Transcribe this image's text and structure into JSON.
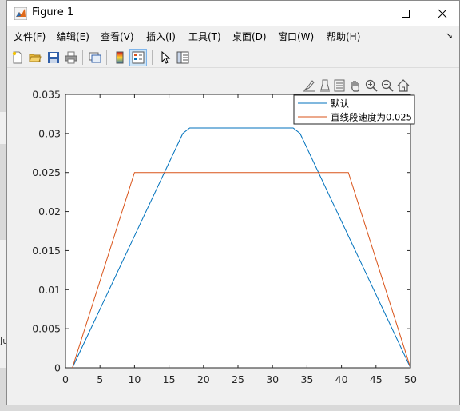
{
  "window": {
    "title": "Figure 1"
  },
  "background_fragments": [
    "Ju"
  ],
  "menu": {
    "items": [
      "文件(F)",
      "编辑(E)",
      "查看(V)",
      "插入(I)",
      "工具(T)",
      "桌面(D)",
      "窗口(W)",
      "帮助(H)"
    ],
    "overflow": "↘"
  },
  "toolbar": {
    "buttons": [
      "new-figure-icon",
      "open-file-icon",
      "save-icon",
      "print-icon",
      "link-plot-icon",
      "insert-colorbar-icon",
      "insert-legend-icon",
      "edit-plot-icon",
      "property-inspector-icon"
    ],
    "active": "insert-legend-icon"
  },
  "axes_toolbar": [
    "brush-icon",
    "data-tips-icon",
    "save-export-icon",
    "pan-icon",
    "zoom-in-icon",
    "zoom-out-icon",
    "restore-view-icon"
  ],
  "colors": {
    "series1": "#0072BD",
    "series2": "#D95319"
  },
  "chart_data": {
    "type": "line",
    "title": "",
    "xlabel": "",
    "ylabel": "",
    "xlim": [
      0,
      50
    ],
    "ylim": [
      0,
      0.035
    ],
    "xticks": [
      0,
      5,
      10,
      15,
      20,
      25,
      30,
      35,
      40,
      45,
      50
    ],
    "yticks": [
      0,
      0.005,
      0.01,
      0.015,
      0.02,
      0.025,
      0.03,
      0.035
    ],
    "ytick_labels": [
      "0",
      "0.005",
      "0.01",
      "0.015",
      "0.02",
      "0.025",
      "0.03",
      "0.035"
    ],
    "grid": false,
    "legend_position": "top-right",
    "series": [
      {
        "name": "默认",
        "color": "#0072BD",
        "x": [
          1,
          17,
          18,
          33,
          34,
          50
        ],
        "y": [
          0,
          0.03,
          0.0307,
          0.0307,
          0.03,
          0
        ]
      },
      {
        "name": "直线段速度为0.025",
        "color": "#D95319",
        "x": [
          1,
          10,
          41,
          50
        ],
        "y": [
          0,
          0.025,
          0.025,
          0
        ]
      }
    ]
  }
}
